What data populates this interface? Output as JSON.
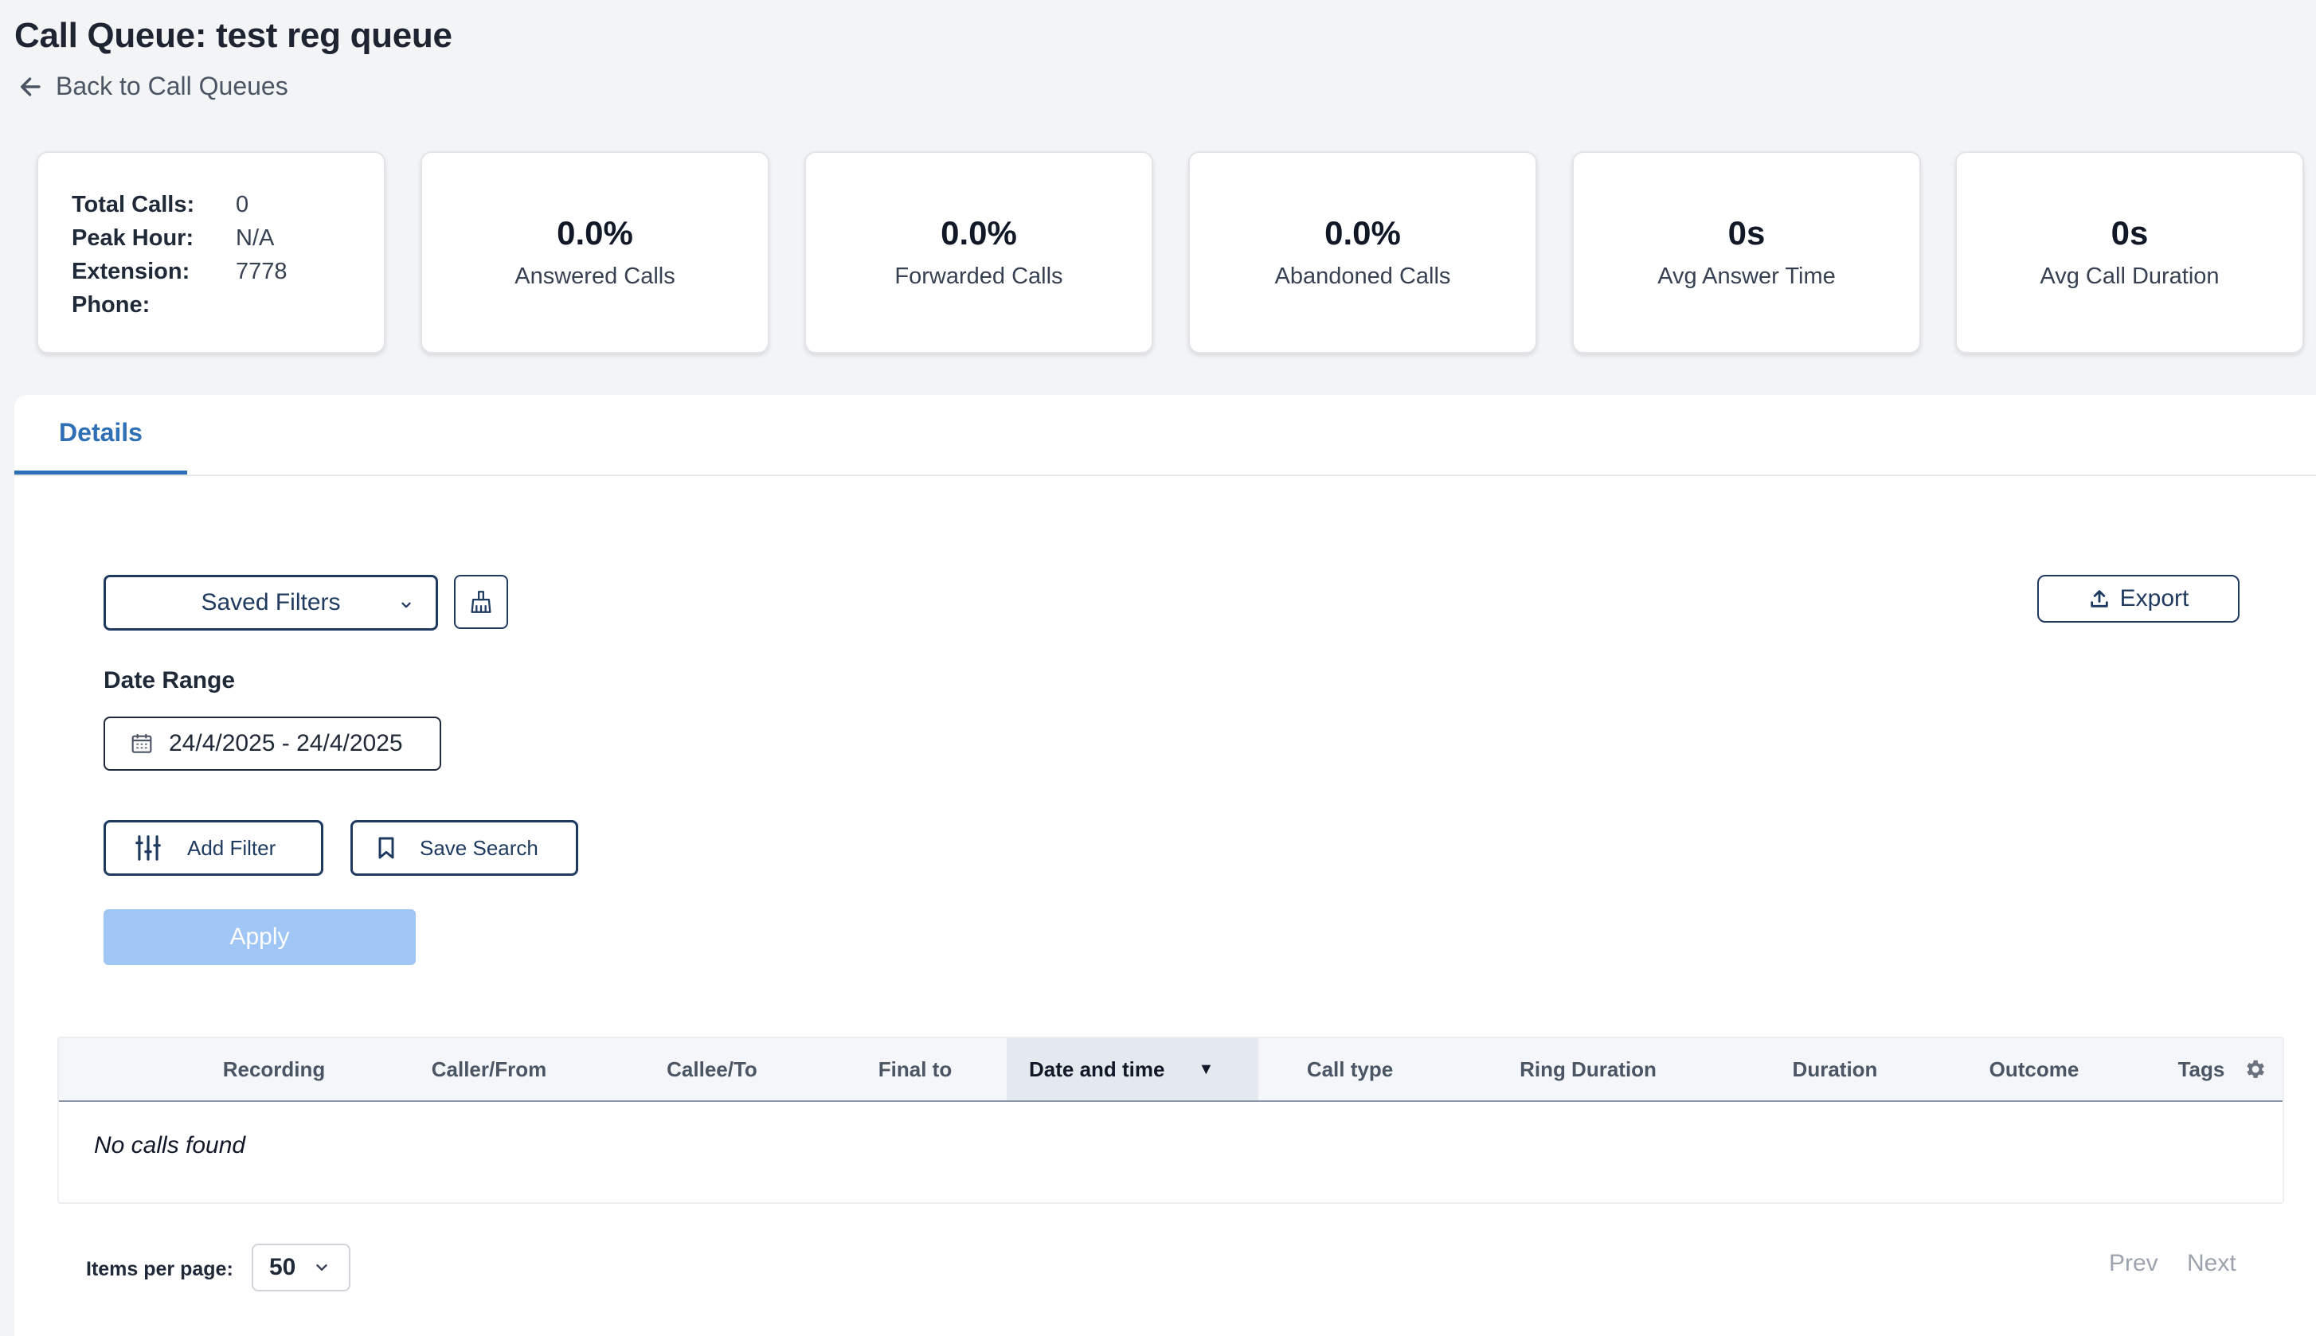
{
  "header": {
    "title": "Call Queue: test reg queue",
    "back_label": "Back to Call Queues"
  },
  "info": {
    "rows": [
      {
        "key": "Total Calls:",
        "value": "0"
      },
      {
        "key": "Peak Hour:",
        "value": "N/A"
      },
      {
        "key": "Extension:",
        "value": "7778"
      },
      {
        "key": "Phone:",
        "value": ""
      }
    ]
  },
  "stats": [
    {
      "value": "0.0%",
      "label": "Answered Calls"
    },
    {
      "value": "0.0%",
      "label": "Forwarded Calls"
    },
    {
      "value": "0.0%",
      "label": "Abandoned Calls"
    },
    {
      "value": "0s",
      "label": "Avg Answer Time"
    },
    {
      "value": "0s",
      "label": "Avg Call Duration"
    }
  ],
  "tabs": [
    {
      "label": "Details",
      "active": true
    }
  ],
  "filters": {
    "saved_filters_label": "Saved Filters",
    "export_label": "Export",
    "date_range_label": "Date Range",
    "date_range_value": "24/4/2025 - 24/4/2025",
    "add_filter_label": "Add Filter",
    "save_search_label": "Save Search",
    "apply_label": "Apply"
  },
  "table": {
    "columns": [
      "Recording",
      "Caller/From",
      "Callee/To",
      "Final to",
      "Date and time",
      "Call type",
      "Ring Duration",
      "Duration",
      "Outcome",
      "Tags"
    ],
    "sort_indicator": "▼",
    "empty_message": "No calls found"
  },
  "pagination": {
    "items_per_page_label": "Items per page:",
    "items_per_page_value": "50",
    "prev_label": "Prev",
    "next_label": "Next"
  },
  "colors": {
    "accent": "#2f6fb5",
    "navy": "#1e3a5f",
    "apply_disabled": "#9fc6f5",
    "background": "#f3f4f6"
  }
}
